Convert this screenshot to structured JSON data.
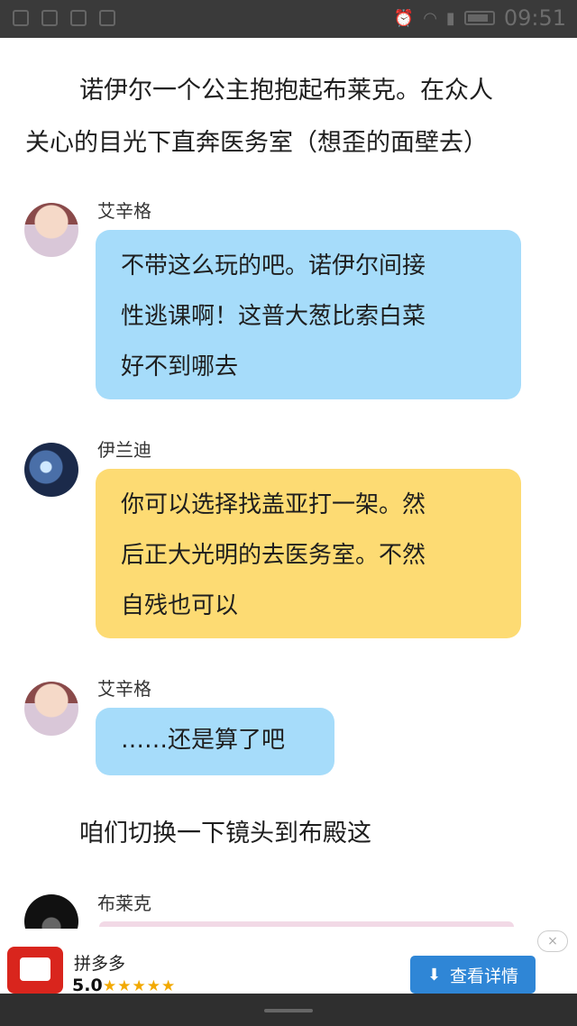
{
  "status_bar": {
    "time": "09:51"
  },
  "story": {
    "paragraph1_line1": "诺伊尔一个公主抱抱起布莱克。在众人",
    "paragraph1_line2": "关心的目光下直奔医务室（想歪的面壁去）",
    "paragraph2": "咱们切换一下镜头到布殿这"
  },
  "messages": [
    {
      "name": "艾辛格",
      "lines": [
        "不带这么玩的吧。诺伊尔间接",
        "性逃课啊！这普大葱比索白菜",
        "好不到哪去"
      ],
      "color": "#a6dcfa"
    },
    {
      "name": "伊兰迪",
      "lines": [
        "你可以选择找盖亚打一架。然",
        "后正大光明的去医务室。不然",
        "自残也可以"
      ],
      "color": "#fddb73"
    },
    {
      "name": "艾辛格",
      "lines": [
        "……还是算了吧"
      ],
      "color": "#a6dcfa"
    },
    {
      "name": "布莱克"
    }
  ],
  "ad": {
    "app_name": "拼多多",
    "rating": "5.0",
    "stars": "★★★★★",
    "button_label": "查看详情",
    "close_symbol": "×"
  }
}
